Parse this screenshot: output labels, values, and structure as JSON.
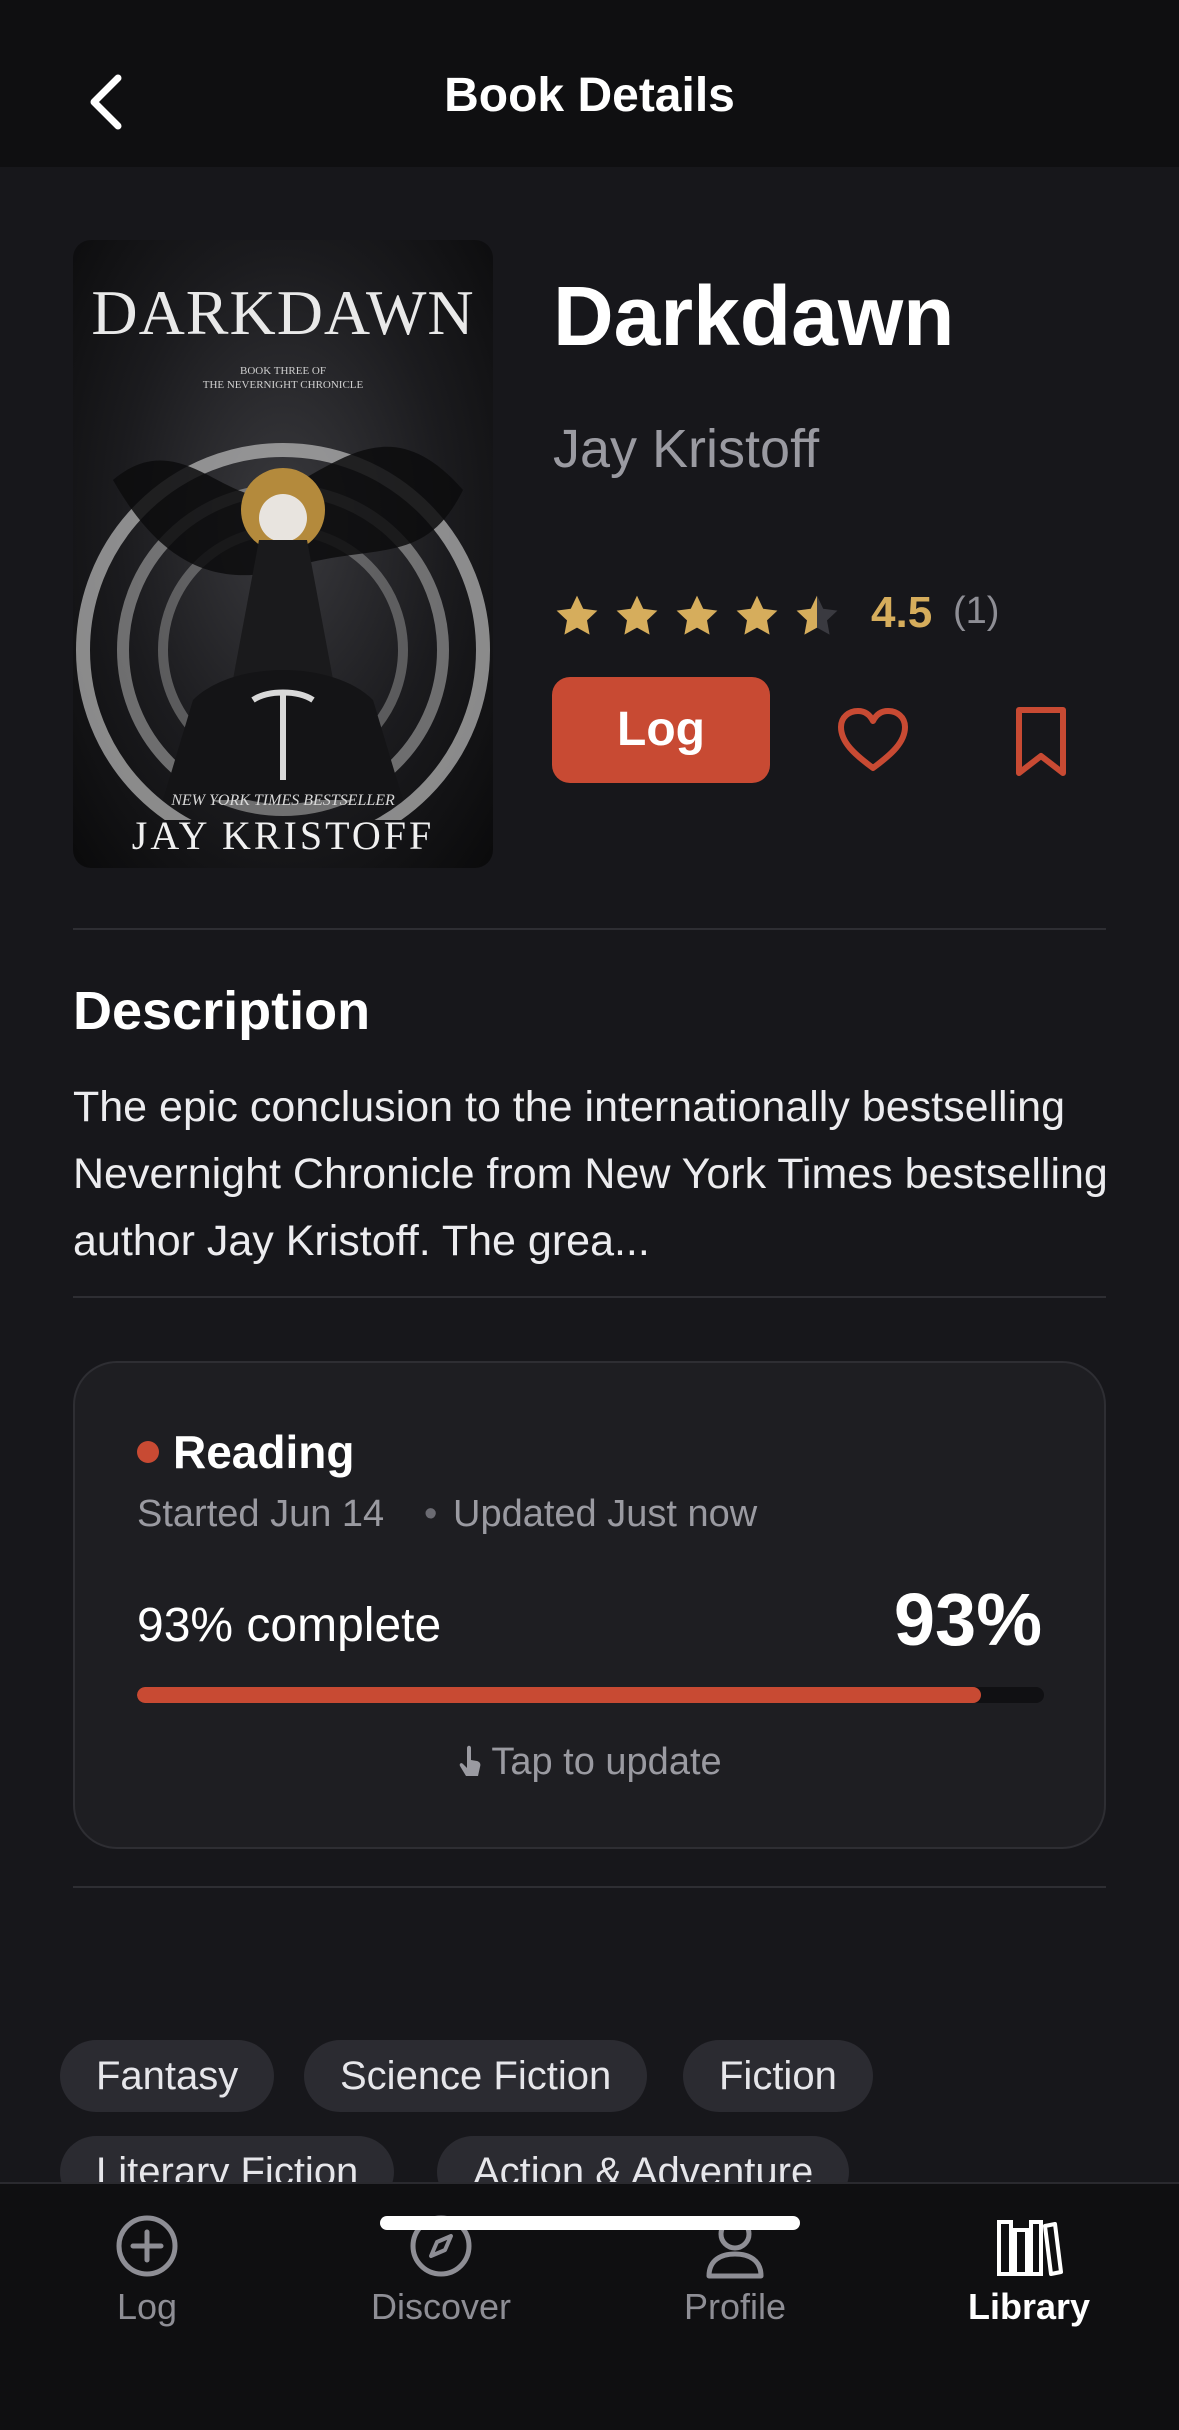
{
  "header": {
    "title": "Book Details",
    "back_icon": "chevron-left-icon"
  },
  "book": {
    "cover": {
      "title": "DARKDAWN",
      "subtitle_line1": "BOOK THREE OF",
      "subtitle_line2": "THE NEVERNIGHT CHRONICLE",
      "bestseller": "NEW YORK TIMES BESTSELLER",
      "author": "JAY KRISTOFF"
    },
    "title": "Darkdawn",
    "author": "Jay Kristoff",
    "rating": "4.5",
    "rating_value": 4.5,
    "rating_count": "(1)",
    "log_label": "Log",
    "favorite_icon": "heart-icon",
    "bookmark_icon": "bookmark-icon"
  },
  "description": {
    "heading": "Description",
    "text": "The epic conclusion to the internationally bestselling Nevernight Chronicle from New York Times bestselling author Jay Kristoff. The grea..."
  },
  "reading": {
    "status": "Reading",
    "started": "Started Jun 14",
    "separator": "•",
    "updated": "Updated Just now",
    "complete_label": "93% complete",
    "percent_label": "93%",
    "progress": 0.93,
    "tap_label": "Tap to update"
  },
  "tags": [
    "Fantasy",
    "Science Fiction",
    "Fiction",
    "Literary Fiction",
    "Action & Adventure"
  ],
  "tabs": [
    {
      "label": "Log",
      "icon": "plus-circle-icon"
    },
    {
      "label": "Discover",
      "icon": "compass-icon"
    },
    {
      "label": "Profile",
      "icon": "person-icon"
    },
    {
      "label": "Library",
      "icon": "library-icon",
      "active": true
    }
  ],
  "colors": {
    "accent": "#c84a33",
    "star": "#d6ad5c",
    "background": "#17171b"
  }
}
